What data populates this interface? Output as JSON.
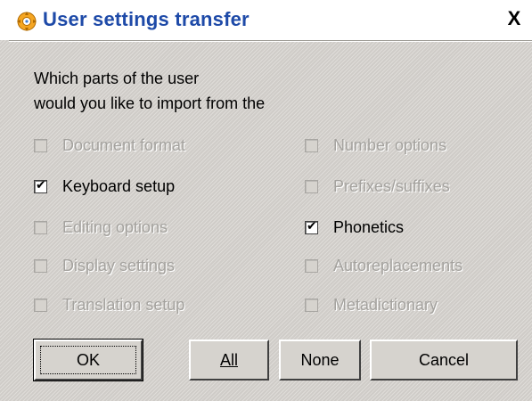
{
  "window": {
    "title": "User settings transfer",
    "close_label": "X"
  },
  "prompt": {
    "line1": "Which parts of the user",
    "line2": "would you like to import from the"
  },
  "options": [
    {
      "label": "Document format",
      "checked": false,
      "enabled": false
    },
    {
      "label": "Keyboard setup",
      "checked": true,
      "enabled": true
    },
    {
      "label": "Editing options",
      "checked": false,
      "enabled": false
    },
    {
      "label": "Display settings",
      "checked": false,
      "enabled": false
    },
    {
      "label": "Translation setup",
      "checked": false,
      "enabled": false
    },
    {
      "label": "Number options",
      "checked": false,
      "enabled": false
    },
    {
      "label": "Prefixes/suffixes",
      "checked": false,
      "enabled": false
    },
    {
      "label": "Phonetics",
      "checked": true,
      "enabled": true
    },
    {
      "label": "Autoreplacements",
      "checked": false,
      "enabled": false
    },
    {
      "label": "Metadictionary",
      "checked": false,
      "enabled": false
    }
  ],
  "buttons": {
    "ok": "OK",
    "all": "All",
    "none": "None",
    "cancel": "Cancel"
  },
  "colors": {
    "title_text": "#1e4aa8",
    "dialog_bg": "#d6d3ce",
    "disabled_text": "#a4a29e"
  },
  "icons": {
    "title": "app-settings-icon",
    "close": "close-icon"
  }
}
